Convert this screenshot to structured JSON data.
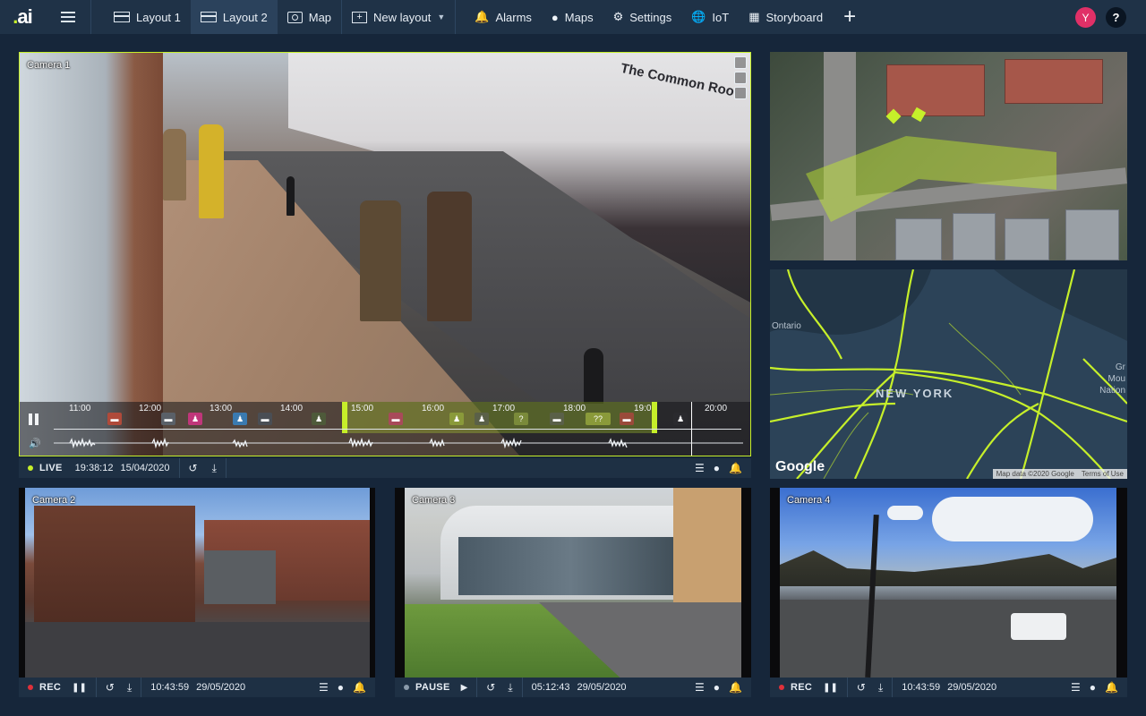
{
  "app": {
    "logo": ".ai"
  },
  "nav": {
    "layout1": "Layout 1",
    "layout2": "Layout 2",
    "map": "Map",
    "new_layout": "New layout",
    "alarms": "Alarms",
    "maps": "Maps",
    "settings": "Settings",
    "iot": "IoT",
    "storyboard": "Storyboard",
    "add": "+"
  },
  "user": {
    "avatar_initial": "Y",
    "help": "?"
  },
  "camera1": {
    "label": "Camera 1",
    "sign_text": "The Common Roo",
    "timeline_ticks": [
      "11:00",
      "12:00",
      "13:00",
      "14:00",
      "15:00",
      "16:00",
      "17:00",
      "18:00",
      "19:0",
      "20:00"
    ],
    "status": {
      "state": "LIVE",
      "time": "19:38:12",
      "date": "15/04/2020"
    }
  },
  "map": {
    "label_ontario": "Ontario",
    "label_newyork": "NEW YORK",
    "label_gr": "Gr",
    "label_mou": "Mou",
    "label_nation": "Nation",
    "google": "Google",
    "map_data": "Map data ©2020 Google",
    "terms": "Terms of Use"
  },
  "camera2": {
    "label": "Camera 2",
    "status": {
      "state": "REC",
      "time": "10:43:59",
      "date": "29/05/2020"
    }
  },
  "camera3": {
    "label": "Camera 3",
    "status": {
      "state": "PAUSE",
      "time": "05:12:43",
      "date": "29/05/2020"
    }
  },
  "camera4": {
    "label": "Camera 4",
    "status": {
      "state": "REC",
      "time": "10:43:59",
      "date": "29/05/2020"
    }
  },
  "colors": {
    "accent": "#c6ef2a",
    "rec": "#e0303a",
    "live": "#c6ef2a",
    "pause": "#8a9aaa"
  }
}
